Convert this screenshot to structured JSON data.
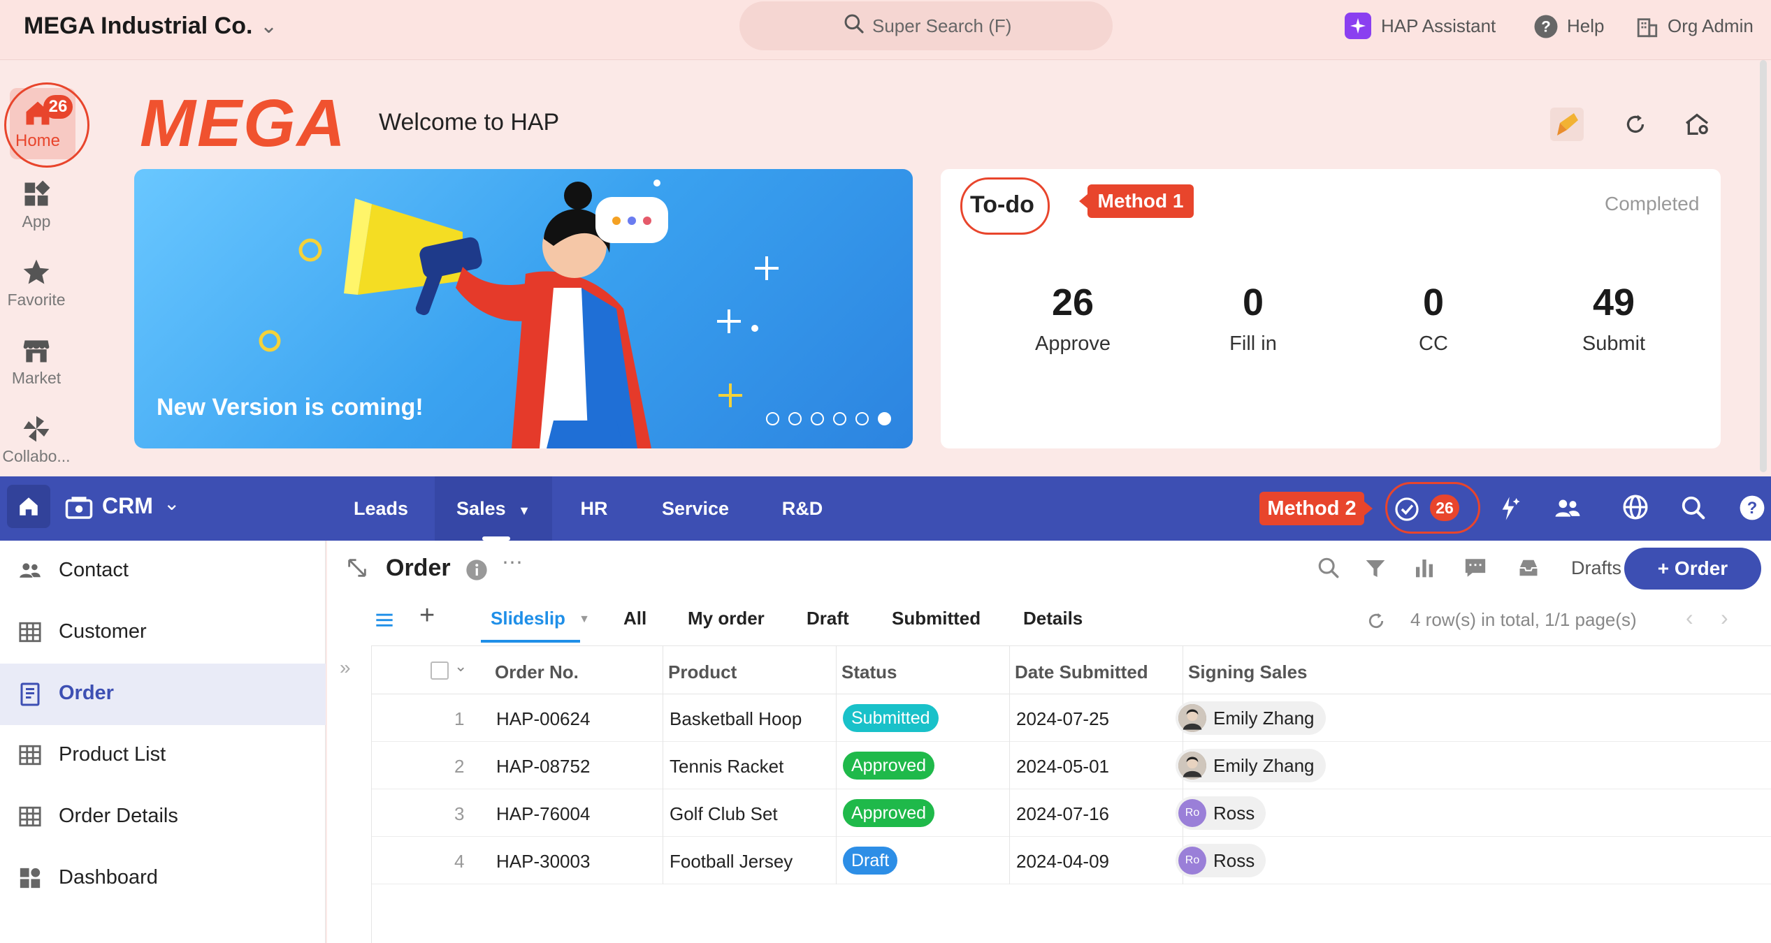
{
  "topbar": {
    "org_name": "MEGA Industrial Co.",
    "search_label": "Super Search (F)",
    "assistant_label": "HAP Assistant",
    "help_label": "Help",
    "org_admin_label": "Org Admin"
  },
  "rail": {
    "home_label": "Home",
    "home_badge": "26",
    "app_label": "App",
    "favorite_label": "Favorite",
    "market_label": "Market",
    "collab_label": "Collabo..."
  },
  "dashboard": {
    "brand_logo": "MEGA",
    "welcome": "Welcome to HAP",
    "banner_caption": "New Version is coming!",
    "banner_active_slide": 6,
    "banner_slide_count": 6
  },
  "todo": {
    "title": "To-do",
    "method1": "Method 1",
    "completed_label": "Completed",
    "stats": [
      {
        "value": "26",
        "label": "Approve"
      },
      {
        "value": "0",
        "label": "Fill in"
      },
      {
        "value": "0",
        "label": "CC"
      },
      {
        "value": "49",
        "label": "Submit"
      }
    ]
  },
  "appnav": {
    "app_name": "CRM",
    "tabs": [
      "Leads",
      "Sales",
      "HR",
      "Service",
      "R&D"
    ],
    "active_tab": "Sales",
    "method2": "Method 2",
    "todo_badge": "26"
  },
  "sidebar": {
    "items": [
      {
        "label": "Contact",
        "icon": "contact-icon"
      },
      {
        "label": "Customer",
        "icon": "table-icon"
      },
      {
        "label": "Order",
        "icon": "order-icon"
      },
      {
        "label": "Product List",
        "icon": "table-icon"
      },
      {
        "label": "Order Details",
        "icon": "table-icon"
      },
      {
        "label": "Dashboard",
        "icon": "dashboard-icon"
      }
    ],
    "active": "Order"
  },
  "main": {
    "title": "Order",
    "drafts_label": "Drafts",
    "add_button": "+ Order",
    "views": [
      "Slideslip",
      "All",
      "My order",
      "Draft",
      "Submitted",
      "Details"
    ],
    "active_view": "Slideslip",
    "row_count": "4 row(s) in total, 1/1 page(s)",
    "columns": [
      "Order No.",
      "Product",
      "Status",
      "Date Submitted",
      "Signing Sales"
    ],
    "rows": [
      {
        "n": "1",
        "order": "HAP-00624",
        "product": "Basketball Hoop",
        "status": "Submitted",
        "status_color": "#19c1c9",
        "date": "2024-07-25",
        "sales": "Emily Zhang",
        "avatar": "photo"
      },
      {
        "n": "2",
        "order": "HAP-08752",
        "product": "Tennis Racket",
        "status": "Approved",
        "status_color": "#1fb94a",
        "date": "2024-05-01",
        "sales": "Emily Zhang",
        "avatar": "photo"
      },
      {
        "n": "3",
        "order": "HAP-76004",
        "product": "Golf Club Set",
        "status": "Approved",
        "status_color": "#1fb94a",
        "date": "2024-07-16",
        "sales": "Ross",
        "avatar": "Ro"
      },
      {
        "n": "4",
        "order": "HAP-30003",
        "product": "Football Jersey",
        "status": "Draft",
        "status_color": "#2d8ee6",
        "date": "2024-04-09",
        "sales": "Ross",
        "avatar": "Ro"
      }
    ]
  },
  "colors": {
    "accent": "#3d4fb3",
    "brand": "#f0522f",
    "annotation": "#e8452c",
    "page_bg": "#fbe9e7"
  }
}
